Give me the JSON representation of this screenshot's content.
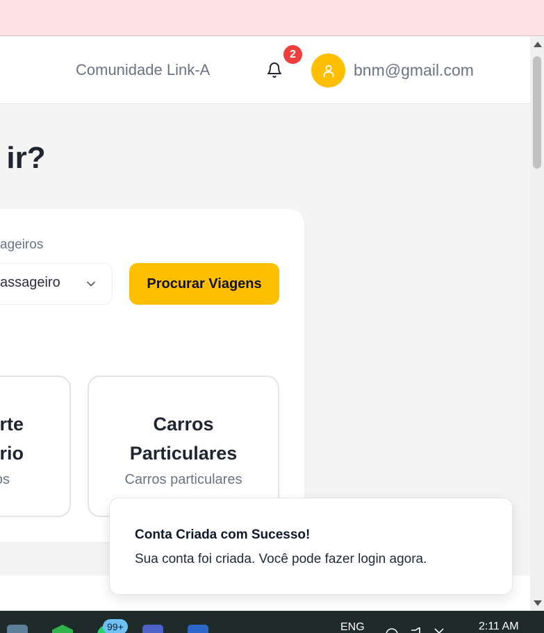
{
  "header": {
    "community_link": "Comunidade Link-A",
    "notification_count": "2",
    "user_email": "bnm@gmail.com"
  },
  "main": {
    "heading": "r ir?",
    "search": {
      "passengers_label": "ageiros",
      "passengers_value": "assageiro",
      "search_button": "Procurar Viagens"
    },
    "categories": [
      {
        "title_line1": "rte",
        "title_line2": "rio",
        "subtitle": "os"
      },
      {
        "title_line1": "Carros",
        "title_line2": "Particulares",
        "subtitle": "Carros particulares"
      }
    ]
  },
  "toast": {
    "title": "Conta Criada com Sucesso!",
    "description": "Sua conta foi criada. Você pode fazer login agora."
  },
  "taskbar": {
    "whatsapp_badge": "99+",
    "language": "ENG",
    "time": "2:11 AM"
  },
  "colors": {
    "accent": "#ffbf00",
    "badge": "#ef3e3e",
    "top_strip": "#fde0e4"
  },
  "icons": [
    "bell-icon",
    "user-icon",
    "chevron-down-icon"
  ]
}
